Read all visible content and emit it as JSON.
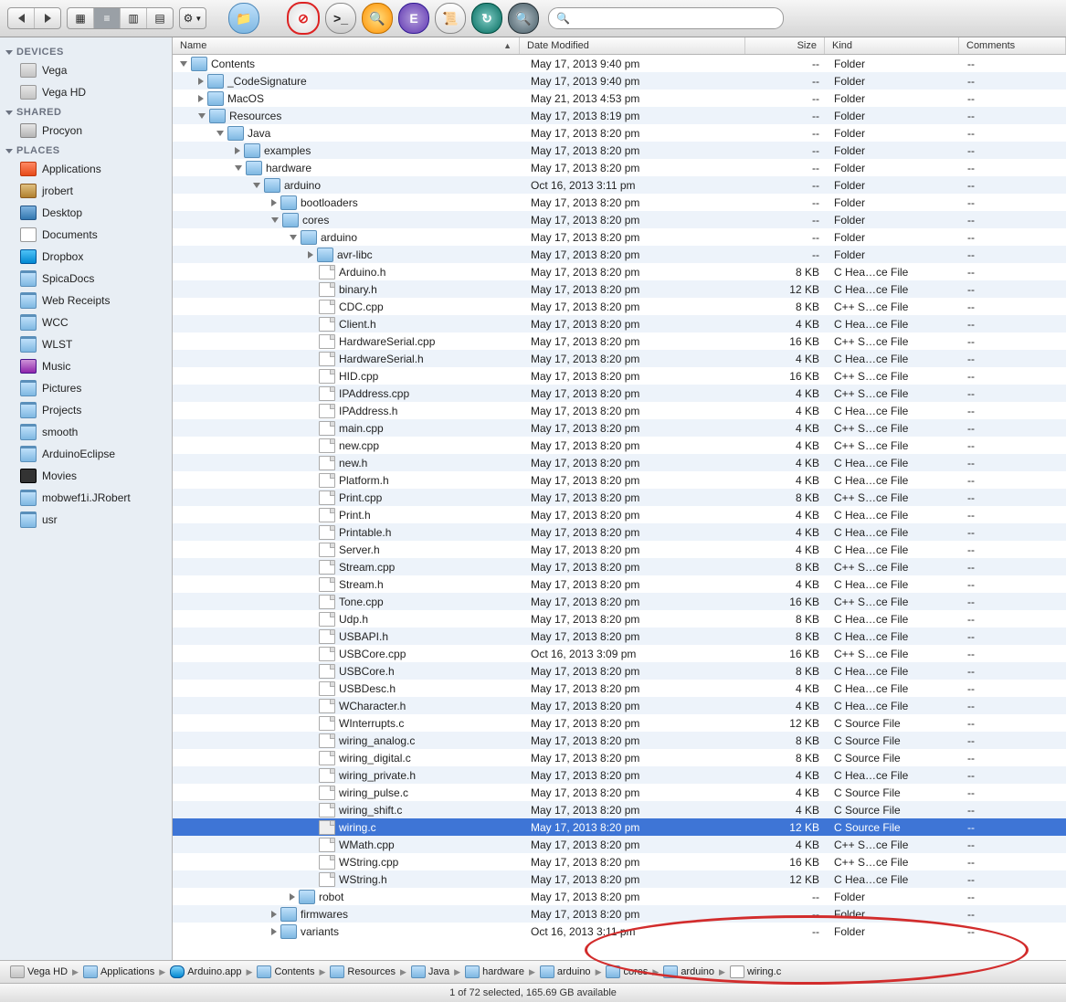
{
  "colors": {
    "selection": "#3e75d6"
  },
  "toolbar": {
    "nav": [
      "back",
      "forward"
    ],
    "views": [
      "icon",
      "list",
      "column",
      "coverflow"
    ],
    "active_view": 1,
    "action": "gear",
    "icons": [
      "new-folder",
      "no-entry",
      "terminal",
      "find-lens",
      "emacs",
      "script",
      "time-machine",
      "spotlight"
    ],
    "search_placeholder": ""
  },
  "sidebar": {
    "sections": [
      {
        "title": "DEVICES",
        "items": [
          {
            "icon": "drive",
            "label": "Vega"
          },
          {
            "icon": "drive",
            "label": "Vega HD"
          }
        ]
      },
      {
        "title": "SHARED",
        "items": [
          {
            "icon": "computer",
            "label": "Procyon"
          }
        ]
      },
      {
        "title": "PLACES",
        "items": [
          {
            "icon": "app",
            "label": "Applications"
          },
          {
            "icon": "home",
            "label": "jrobert"
          },
          {
            "icon": "desktop",
            "label": "Desktop"
          },
          {
            "icon": "doc",
            "label": "Documents"
          },
          {
            "icon": "dropbox",
            "label": "Dropbox"
          },
          {
            "icon": "folder",
            "label": "SpicaDocs"
          },
          {
            "icon": "folder",
            "label": "Web Receipts"
          },
          {
            "icon": "folder",
            "label": "WCC"
          },
          {
            "icon": "folder",
            "label": "WLST"
          },
          {
            "icon": "music",
            "label": "Music"
          },
          {
            "icon": "folder",
            "label": "Pictures"
          },
          {
            "icon": "folder",
            "label": "Projects"
          },
          {
            "icon": "folder",
            "label": "smooth"
          },
          {
            "icon": "folder",
            "label": "ArduinoEclipse"
          },
          {
            "icon": "movies",
            "label": "Movies"
          },
          {
            "icon": "folder",
            "label": "mobwef1i.JRobert"
          },
          {
            "icon": "folder",
            "label": "usr"
          }
        ]
      }
    ]
  },
  "columns": {
    "name": "Name",
    "date": "Date Modified",
    "size": "Size",
    "kind": "Kind",
    "comments": "Comments"
  },
  "rows": [
    {
      "depth": 0,
      "disc": "open",
      "icon": "folder",
      "name": "Contents",
      "date": "May 17, 2013 9:40 pm",
      "size": "--",
      "kind": "Folder",
      "comments": "--"
    },
    {
      "depth": 1,
      "disc": "closed",
      "icon": "folder",
      "name": "_CodeSignature",
      "date": "May 17, 2013 9:40 pm",
      "size": "--",
      "kind": "Folder",
      "comments": "--"
    },
    {
      "depth": 1,
      "disc": "closed",
      "icon": "folder",
      "name": "MacOS",
      "date": "May 21, 2013 4:53 pm",
      "size": "--",
      "kind": "Folder",
      "comments": "--"
    },
    {
      "depth": 1,
      "disc": "open",
      "icon": "folder",
      "name": "Resources",
      "date": "May 17, 2013 8:19 pm",
      "size": "--",
      "kind": "Folder",
      "comments": "--"
    },
    {
      "depth": 2,
      "disc": "open",
      "icon": "folder",
      "name": "Java",
      "date": "May 17, 2013 8:20 pm",
      "size": "--",
      "kind": "Folder",
      "comments": "--"
    },
    {
      "depth": 3,
      "disc": "closed",
      "icon": "folder",
      "name": "examples",
      "date": "May 17, 2013 8:20 pm",
      "size": "--",
      "kind": "Folder",
      "comments": "--"
    },
    {
      "depth": 3,
      "disc": "open",
      "icon": "folder",
      "name": "hardware",
      "date": "May 17, 2013 8:20 pm",
      "size": "--",
      "kind": "Folder",
      "comments": "--"
    },
    {
      "depth": 4,
      "disc": "open",
      "icon": "folder",
      "name": "arduino",
      "date": "Oct 16, 2013 3:11 pm",
      "size": "--",
      "kind": "Folder",
      "comments": "--"
    },
    {
      "depth": 5,
      "disc": "closed",
      "icon": "folder",
      "name": "bootloaders",
      "date": "May 17, 2013 8:20 pm",
      "size": "--",
      "kind": "Folder",
      "comments": "--"
    },
    {
      "depth": 5,
      "disc": "open",
      "icon": "folder",
      "name": "cores",
      "date": "May 17, 2013 8:20 pm",
      "size": "--",
      "kind": "Folder",
      "comments": "--"
    },
    {
      "depth": 6,
      "disc": "open",
      "icon": "folder",
      "name": "arduino",
      "date": "May 17, 2013 8:20 pm",
      "size": "--",
      "kind": "Folder",
      "comments": "--"
    },
    {
      "depth": 7,
      "disc": "closed",
      "icon": "folder",
      "name": "avr-libc",
      "date": "May 17, 2013 8:20 pm",
      "size": "--",
      "kind": "Folder",
      "comments": "--"
    },
    {
      "depth": 7,
      "disc": "none",
      "icon": "file",
      "name": "Arduino.h",
      "date": "May 17, 2013 8:20 pm",
      "size": "8 KB",
      "kind": "C Hea…ce File",
      "comments": "--"
    },
    {
      "depth": 7,
      "disc": "none",
      "icon": "file",
      "name": "binary.h",
      "date": "May 17, 2013 8:20 pm",
      "size": "12 KB",
      "kind": "C Hea…ce File",
      "comments": "--"
    },
    {
      "depth": 7,
      "disc": "none",
      "icon": "file",
      "name": "CDC.cpp",
      "date": "May 17, 2013 8:20 pm",
      "size": "8 KB",
      "kind": "C++ S…ce File",
      "comments": "--"
    },
    {
      "depth": 7,
      "disc": "none",
      "icon": "file",
      "name": "Client.h",
      "date": "May 17, 2013 8:20 pm",
      "size": "4 KB",
      "kind": "C Hea…ce File",
      "comments": "--"
    },
    {
      "depth": 7,
      "disc": "none",
      "icon": "file",
      "name": "HardwareSerial.cpp",
      "date": "May 17, 2013 8:20 pm",
      "size": "16 KB",
      "kind": "C++ S…ce File",
      "comments": "--"
    },
    {
      "depth": 7,
      "disc": "none",
      "icon": "file",
      "name": "HardwareSerial.h",
      "date": "May 17, 2013 8:20 pm",
      "size": "4 KB",
      "kind": "C Hea…ce File",
      "comments": "--"
    },
    {
      "depth": 7,
      "disc": "none",
      "icon": "file",
      "name": "HID.cpp",
      "date": "May 17, 2013 8:20 pm",
      "size": "16 KB",
      "kind": "C++ S…ce File",
      "comments": "--"
    },
    {
      "depth": 7,
      "disc": "none",
      "icon": "file",
      "name": "IPAddress.cpp",
      "date": "May 17, 2013 8:20 pm",
      "size": "4 KB",
      "kind": "C++ S…ce File",
      "comments": "--"
    },
    {
      "depth": 7,
      "disc": "none",
      "icon": "file",
      "name": "IPAddress.h",
      "date": "May 17, 2013 8:20 pm",
      "size": "4 KB",
      "kind": "C Hea…ce File",
      "comments": "--"
    },
    {
      "depth": 7,
      "disc": "none",
      "icon": "file",
      "name": "main.cpp",
      "date": "May 17, 2013 8:20 pm",
      "size": "4 KB",
      "kind": "C++ S…ce File",
      "comments": "--"
    },
    {
      "depth": 7,
      "disc": "none",
      "icon": "file",
      "name": "new.cpp",
      "date": "May 17, 2013 8:20 pm",
      "size": "4 KB",
      "kind": "C++ S…ce File",
      "comments": "--"
    },
    {
      "depth": 7,
      "disc": "none",
      "icon": "file",
      "name": "new.h",
      "date": "May 17, 2013 8:20 pm",
      "size": "4 KB",
      "kind": "C Hea…ce File",
      "comments": "--"
    },
    {
      "depth": 7,
      "disc": "none",
      "icon": "file",
      "name": "Platform.h",
      "date": "May 17, 2013 8:20 pm",
      "size": "4 KB",
      "kind": "C Hea…ce File",
      "comments": "--"
    },
    {
      "depth": 7,
      "disc": "none",
      "icon": "file",
      "name": "Print.cpp",
      "date": "May 17, 2013 8:20 pm",
      "size": "8 KB",
      "kind": "C++ S…ce File",
      "comments": "--"
    },
    {
      "depth": 7,
      "disc": "none",
      "icon": "file",
      "name": "Print.h",
      "date": "May 17, 2013 8:20 pm",
      "size": "4 KB",
      "kind": "C Hea…ce File",
      "comments": "--"
    },
    {
      "depth": 7,
      "disc": "none",
      "icon": "file",
      "name": "Printable.h",
      "date": "May 17, 2013 8:20 pm",
      "size": "4 KB",
      "kind": "C Hea…ce File",
      "comments": "--"
    },
    {
      "depth": 7,
      "disc": "none",
      "icon": "file",
      "name": "Server.h",
      "date": "May 17, 2013 8:20 pm",
      "size": "4 KB",
      "kind": "C Hea…ce File",
      "comments": "--"
    },
    {
      "depth": 7,
      "disc": "none",
      "icon": "file",
      "name": "Stream.cpp",
      "date": "May 17, 2013 8:20 pm",
      "size": "8 KB",
      "kind": "C++ S…ce File",
      "comments": "--"
    },
    {
      "depth": 7,
      "disc": "none",
      "icon": "file",
      "name": "Stream.h",
      "date": "May 17, 2013 8:20 pm",
      "size": "4 KB",
      "kind": "C Hea…ce File",
      "comments": "--"
    },
    {
      "depth": 7,
      "disc": "none",
      "icon": "file",
      "name": "Tone.cpp",
      "date": "May 17, 2013 8:20 pm",
      "size": "16 KB",
      "kind": "C++ S…ce File",
      "comments": "--"
    },
    {
      "depth": 7,
      "disc": "none",
      "icon": "file",
      "name": "Udp.h",
      "date": "May 17, 2013 8:20 pm",
      "size": "8 KB",
      "kind": "C Hea…ce File",
      "comments": "--"
    },
    {
      "depth": 7,
      "disc": "none",
      "icon": "file",
      "name": "USBAPI.h",
      "date": "May 17, 2013 8:20 pm",
      "size": "8 KB",
      "kind": "C Hea…ce File",
      "comments": "--"
    },
    {
      "depth": 7,
      "disc": "none",
      "icon": "file",
      "name": "USBCore.cpp",
      "date": "Oct 16, 2013 3:09 pm",
      "size": "16 KB",
      "kind": "C++ S…ce File",
      "comments": "--"
    },
    {
      "depth": 7,
      "disc": "none",
      "icon": "file",
      "name": "USBCore.h",
      "date": "May 17, 2013 8:20 pm",
      "size": "8 KB",
      "kind": "C Hea…ce File",
      "comments": "--"
    },
    {
      "depth": 7,
      "disc": "none",
      "icon": "file",
      "name": "USBDesc.h",
      "date": "May 17, 2013 8:20 pm",
      "size": "4 KB",
      "kind": "C Hea…ce File",
      "comments": "--"
    },
    {
      "depth": 7,
      "disc": "none",
      "icon": "file",
      "name": "WCharacter.h",
      "date": "May 17, 2013 8:20 pm",
      "size": "4 KB",
      "kind": "C Hea…ce File",
      "comments": "--"
    },
    {
      "depth": 7,
      "disc": "none",
      "icon": "file",
      "name": "WInterrupts.c",
      "date": "May 17, 2013 8:20 pm",
      "size": "12 KB",
      "kind": "C Source File",
      "comments": "--"
    },
    {
      "depth": 7,
      "disc": "none",
      "icon": "file",
      "name": "wiring_analog.c",
      "date": "May 17, 2013 8:20 pm",
      "size": "8 KB",
      "kind": "C Source File",
      "comments": "--"
    },
    {
      "depth": 7,
      "disc": "none",
      "icon": "file",
      "name": "wiring_digital.c",
      "date": "May 17, 2013 8:20 pm",
      "size": "8 KB",
      "kind": "C Source File",
      "comments": "--"
    },
    {
      "depth": 7,
      "disc": "none",
      "icon": "file",
      "name": "wiring_private.h",
      "date": "May 17, 2013 8:20 pm",
      "size": "4 KB",
      "kind": "C Hea…ce File",
      "comments": "--"
    },
    {
      "depth": 7,
      "disc": "none",
      "icon": "file",
      "name": "wiring_pulse.c",
      "date": "May 17, 2013 8:20 pm",
      "size": "4 KB",
      "kind": "C Source File",
      "comments": "--"
    },
    {
      "depth": 7,
      "disc": "none",
      "icon": "file",
      "name": "wiring_shift.c",
      "date": "May 17, 2013 8:20 pm",
      "size": "4 KB",
      "kind": "C Source File",
      "comments": "--"
    },
    {
      "depth": 7,
      "disc": "none",
      "icon": "file",
      "name": "wiring.c",
      "date": "May 17, 2013 8:20 pm",
      "size": "12 KB",
      "kind": "C Source File",
      "comments": "--",
      "selected": true
    },
    {
      "depth": 7,
      "disc": "none",
      "icon": "file",
      "name": "WMath.cpp",
      "date": "May 17, 2013 8:20 pm",
      "size": "4 KB",
      "kind": "C++ S…ce File",
      "comments": "--"
    },
    {
      "depth": 7,
      "disc": "none",
      "icon": "file",
      "name": "WString.cpp",
      "date": "May 17, 2013 8:20 pm",
      "size": "16 KB",
      "kind": "C++ S…ce File",
      "comments": "--"
    },
    {
      "depth": 7,
      "disc": "none",
      "icon": "file",
      "name": "WString.h",
      "date": "May 17, 2013 8:20 pm",
      "size": "12 KB",
      "kind": "C Hea…ce File",
      "comments": "--"
    },
    {
      "depth": 6,
      "disc": "closed",
      "icon": "folder",
      "name": "robot",
      "date": "May 17, 2013 8:20 pm",
      "size": "--",
      "kind": "Folder",
      "comments": "--"
    },
    {
      "depth": 5,
      "disc": "closed",
      "icon": "folder",
      "name": "firmwares",
      "date": "May 17, 2013 8:20 pm",
      "size": "--",
      "kind": "Folder",
      "comments": "--"
    },
    {
      "depth": 5,
      "disc": "closed",
      "icon": "folder",
      "name": "variants",
      "date": "Oct 16, 2013 3:11 pm",
      "size": "--",
      "kind": "Folder",
      "comments": "--"
    }
  ],
  "path": [
    {
      "icon": "drive",
      "label": "Vega HD"
    },
    {
      "icon": "folder",
      "label": "Applications"
    },
    {
      "icon": "app",
      "label": "Arduino.app"
    },
    {
      "icon": "folder",
      "label": "Contents"
    },
    {
      "icon": "folder",
      "label": "Resources"
    },
    {
      "icon": "folder",
      "label": "Java"
    },
    {
      "icon": "folder",
      "label": "hardware"
    },
    {
      "icon": "folder",
      "label": "arduino"
    },
    {
      "icon": "folder",
      "label": "cores"
    },
    {
      "icon": "folder",
      "label": "arduino"
    },
    {
      "icon": "file",
      "label": "wiring.c"
    }
  ],
  "status": "1 of 72 selected, 165.69 GB available"
}
